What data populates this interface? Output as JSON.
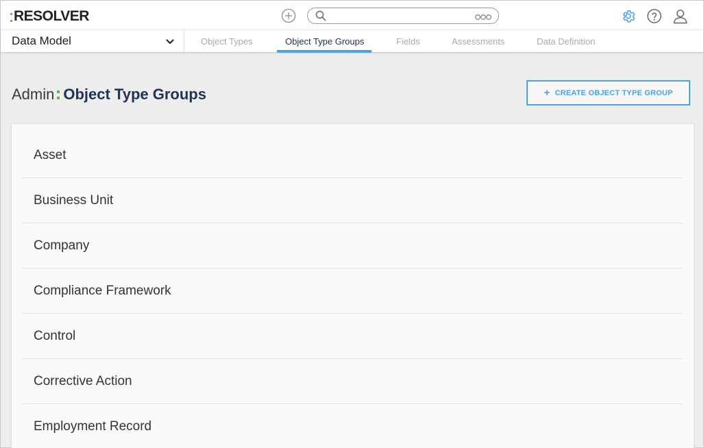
{
  "app": {
    "logo_text": "RESOLVER"
  },
  "search": {
    "placeholder": ""
  },
  "subnav": {
    "selector_label": "Data Model",
    "tabs": [
      {
        "label": "Object Types"
      },
      {
        "label": "Object Type Groups"
      },
      {
        "label": "Fields"
      },
      {
        "label": "Assessments"
      },
      {
        "label": "Data Definition"
      }
    ],
    "active_tab": "Object Type Groups"
  },
  "header": {
    "prefix": "Admin",
    "title": "Object Type Groups",
    "create_button": "CREATE OBJECT TYPE GROUP"
  },
  "groups": [
    {
      "label": "Asset"
    },
    {
      "label": "Business Unit"
    },
    {
      "label": "Company"
    },
    {
      "label": "Compliance Framework"
    },
    {
      "label": "Control"
    },
    {
      "label": "Corrective Action"
    },
    {
      "label": "Employment Record"
    }
  ],
  "icons": {
    "add": "plus-circle-icon",
    "search": "search-icon",
    "more": "more-options-icon",
    "settings": "gear-icon",
    "help": "help-icon",
    "user": "user-icon",
    "chevron": "chevron-down-icon"
  },
  "colors": {
    "accent": "#4aa3df",
    "brand_green": "#66b844",
    "title_navy": "#1f3358",
    "background": "#ededed"
  }
}
